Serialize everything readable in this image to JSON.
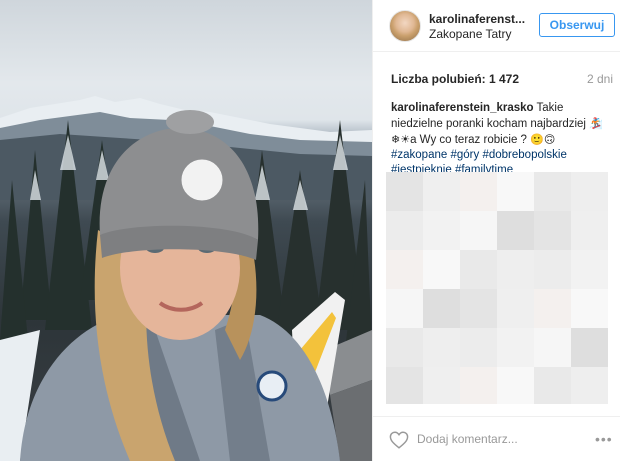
{
  "header": {
    "username": "karolinaferenst...",
    "location": "Zakopane Tatry",
    "follow_label": "Obserwuj"
  },
  "stats": {
    "likes_label": "Liczba polubień: 1 472",
    "time_ago": "2 dni"
  },
  "caption": {
    "author": "karolinaferenstein_krasko",
    "text_1": " Takie niedzielne poranki kocham najbardziej ",
    "emoji_1": "🏂",
    "emoji_2": "❄",
    "emoji_3": "☀",
    "text_2": "a Wy co teraz robicie ? ",
    "emoji_4": "🙂",
    "emoji_5": "🙃",
    "hashtags": [
      "#zakopane",
      "#góry",
      "#dobrebopolskie",
      "#jestpieknie",
      "#familytime"
    ]
  },
  "comment_bar": {
    "placeholder": "Dodaj komentarz...",
    "more_label": "•••"
  },
  "colors": {
    "accent": "#3897f0",
    "hashtag": "#003569",
    "muted": "#999999"
  },
  "icons": {
    "like": "heart-outline-icon",
    "more": "more-options-icon"
  }
}
